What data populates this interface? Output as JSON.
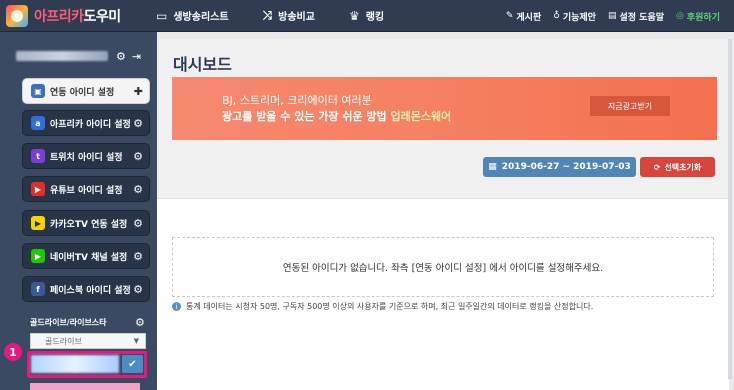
{
  "topbar": {
    "logo_part1": "아프리카",
    "logo_part2": "도우미",
    "nav": [
      {
        "icon": "monitor-icon",
        "glyph": "▭",
        "label": "생방송리스트"
      },
      {
        "icon": "shuffle-icon",
        "glyph": "⤨",
        "label": "방송비교"
      },
      {
        "icon": "trophy-icon",
        "glyph": "♛",
        "label": "랭킹"
      }
    ],
    "right_nav": [
      {
        "icon": "pencil-icon",
        "glyph": "✎",
        "label": "게시판"
      },
      {
        "icon": "bulb-icon",
        "glyph": "♁",
        "label": "기능제안"
      },
      {
        "icon": "book-icon",
        "glyph": "▤",
        "label": "설정 도움말"
      },
      {
        "icon": "money-icon",
        "glyph": "◎",
        "label": "후원하기"
      }
    ]
  },
  "sidebar": {
    "items": [
      {
        "label": "연동 아이디 설정",
        "icon": "link-id-icon",
        "color": "#ffffff"
      },
      {
        "label": "아프리카 아이디 설정",
        "icon": "afreeca-icon",
        "color": "#2f6fd6"
      },
      {
        "label": "트위치 아이디 설정",
        "icon": "twitch-icon",
        "color": "#7b3fd6"
      },
      {
        "label": "유튜브 아이디 설정",
        "icon": "youtube-icon",
        "color": "#e52d27"
      },
      {
        "label": "카카오TV 연동 설정",
        "icon": "kakaotv-icon",
        "color": "#f6d400"
      },
      {
        "label": "네이버TV 채널 설정",
        "icon": "navertv-icon",
        "color": "#1ec800"
      },
      {
        "label": "페이스북 아이디 설정",
        "icon": "facebook-icon",
        "color": "#3b5998"
      }
    ],
    "gold_label": "골드라이브/라이브스타",
    "gold_select": "골드라이브",
    "marker": "1"
  },
  "main": {
    "title": "대시보드",
    "ad_line1": "BJ, 스트리머, 크리에이터 여러분",
    "ad_line2_prefix": "광고를 받을 수 있는 가장 쉬운 방법 ",
    "ad_line2_brand": "업레몬스웨어",
    "ad_button": "지금광고받기",
    "date_range": "2019-06-27 ~ 2019-07-03",
    "reset_button": "선택초기화",
    "empty_message": "연동된 아이디가 없습니다. 좌측 [연동 아이디 설정] 에서 아이디를 설정해주세요.",
    "note": "통계 데이터는 시청자 50명, 구독자 500명 이상의 사용자를 기준으로 하며, 최근 일주일간의 데이터로 랭킹을 산정합니다."
  }
}
